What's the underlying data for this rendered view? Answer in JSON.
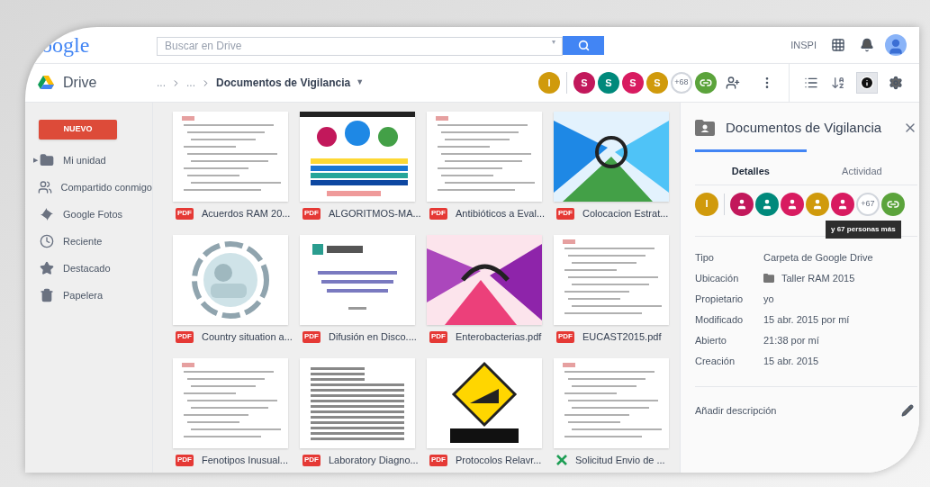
{
  "header": {
    "logo": "oogle",
    "search": {
      "placeholder": "Buscar en Drive",
      "dropdown": "▾"
    },
    "account": "INSPI"
  },
  "toolbar": {
    "app_name": "Drive",
    "breadcrumb": [
      "...",
      "...",
      "Documentos de Vigilancia"
    ],
    "breadcrumb_menu": "▼",
    "avatars": [
      {
        "kind": "letter",
        "label": "I",
        "color": "#d09a0c"
      },
      {
        "kind": "divider"
      },
      {
        "kind": "letter",
        "label": "S",
        "color": "#c2185b"
      },
      {
        "kind": "letter",
        "label": "S",
        "color": "#00897b"
      },
      {
        "kind": "letter",
        "label": "S",
        "color": "#d81b60"
      },
      {
        "kind": "letter",
        "label": "S",
        "color": "#d09a0c"
      },
      {
        "kind": "more",
        "label": "+68"
      },
      {
        "kind": "link",
        "color": "#5ba33b"
      }
    ],
    "info_toggle": {
      "selected": true
    }
  },
  "sidebar": {
    "new_button": "NUEVO",
    "items": [
      {
        "kind": "drive",
        "label": "Mi unidad",
        "selected": false,
        "expander": "▶"
      },
      {
        "kind": "shared",
        "label": "Compartido conmigo",
        "selected": false
      },
      {
        "kind": "photos",
        "label": "Google Fotos",
        "selected": false
      },
      {
        "kind": "recent",
        "label": "Reciente",
        "selected": false
      },
      {
        "kind": "starred",
        "label": "Destacado",
        "selected": false
      },
      {
        "kind": "trash",
        "label": "Papelera",
        "selected": false
      }
    ]
  },
  "files": [
    {
      "name": "Acuerdos RAM 20...",
      "kind": "pdf",
      "badge": "PDF"
    },
    {
      "name": "ALGORITMOS-MA...",
      "kind": "pdf",
      "badge": "PDF"
    },
    {
      "name": "Antibióticos a Eval...",
      "kind": "pdf",
      "badge": "PDF"
    },
    {
      "name": "Colocacion Estrat...",
      "kind": "pdf",
      "badge": "PDF"
    },
    {
      "name": "Country situation a...",
      "kind": "pdf",
      "badge": "PDF"
    },
    {
      "name": "Difusión en Disco....",
      "kind": "pdf",
      "badge": "PDF"
    },
    {
      "name": "Enterobacterias.pdf",
      "kind": "pdf",
      "badge": "PDF"
    },
    {
      "name": "EUCAST2015.pdf",
      "kind": "pdf",
      "badge": "PDF"
    },
    {
      "name": "Fenotipos Inusual...",
      "kind": "pdf",
      "badge": "PDF"
    },
    {
      "name": "Laboratory Diagno...",
      "kind": "pdf",
      "badge": "PDF"
    },
    {
      "name": "Protocolos Relavr...",
      "kind": "pdf",
      "badge": "PDF"
    },
    {
      "name": "Solicitud Envio de ...",
      "kind": "sheet"
    }
  ],
  "details": {
    "title": "Documentos de Vigilancia",
    "tabs": [
      {
        "label": "Detalles",
        "selected": true
      },
      {
        "label": "Actividad",
        "selected": false
      }
    ],
    "avatars": [
      {
        "kind": "letter",
        "label": "I",
        "color": "#d09a0c"
      },
      {
        "kind": "divider"
      },
      {
        "kind": "person",
        "color": "#c2185b"
      },
      {
        "kind": "person",
        "color": "#00897b"
      },
      {
        "kind": "person",
        "color": "#d81b60"
      },
      {
        "kind": "person",
        "color": "#d09a0c"
      },
      {
        "kind": "person",
        "color": "#d81b60"
      },
      {
        "kind": "more",
        "label": "+67"
      },
      {
        "kind": "link",
        "color": "#5ba33b"
      }
    ],
    "tooltip": "y 67 personas más",
    "properties": [
      {
        "label": "Tipo",
        "value": "Carpeta de Google Drive",
        "kind": "text"
      },
      {
        "label": "Ubicación",
        "value": "Taller RAM 2015",
        "kind": "folder"
      },
      {
        "label": "Propietario",
        "value": "yo",
        "kind": "text"
      },
      {
        "label": "Modificado",
        "value": "15 abr. 2015 por mí",
        "kind": "text"
      },
      {
        "label": "Abierto",
        "value": "21:38 por mí",
        "kind": "text"
      },
      {
        "label": "Creación",
        "value": "15 abr. 2015",
        "kind": "text"
      }
    ],
    "description_placeholder": "Añadir descripción"
  }
}
